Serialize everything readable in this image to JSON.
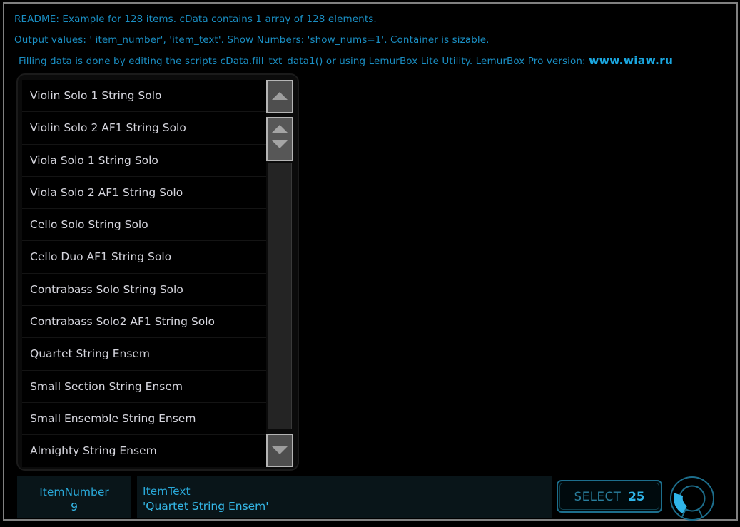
{
  "readme": {
    "line1": "README: Example for 128 items.  cData contains 1 array of 128 elements.",
    "line2": "Output values: ' item_number', 'item_text'.   Show Numbers: 'show_nums=1'.   Container is sizable.",
    "line3": "Filling data is done by editing the scripts  cData.fill_txt_data1() or using LemurBox Lite Utility.  LemurBox Pro version:",
    "url": "www.wiaw.ru"
  },
  "list": {
    "items": [
      "Violin Solo 1 String Solo",
      "Violin Solo 2 AF1 String Solo",
      "Viola Solo 1 String Solo",
      "Viola Solo 2 AF1 String Solo",
      "Cello Solo String Solo",
      "Cello Duo AF1 String Solo",
      "Contrabass Solo String Solo",
      "Contrabass Solo2 AF1 String Solo",
      "Quartet String Ensem",
      "Small Section String Ensem",
      "Small Ensemble String Ensem",
      "Almighty String Ensem"
    ]
  },
  "scrollbar": {
    "up_arrow_icon": "triangle-up-icon",
    "down_arrow_icon": "triangle-down-icon",
    "thumb_up_icon": "triangle-up-icon",
    "thumb_down_icon": "triangle-down-icon"
  },
  "outputs": {
    "item_number_label": "ItemNumber",
    "item_number_value": "9",
    "item_text_label": "ItemText",
    "item_text_value": "'Quartet String Ensem'"
  },
  "select": {
    "label": "SELECT",
    "value": "25"
  },
  "knob": {
    "icon": "rotary-knob-icon",
    "arc_color": "#2fb4e8",
    "ring_color": "#1d6e8c"
  },
  "colors": {
    "accent": "#29a8d8",
    "readme_text": "#1a8fc4",
    "list_text": "#d6d6de",
    "panel_bg": "#091519",
    "frame_border": "#808080",
    "background": "#000000"
  }
}
